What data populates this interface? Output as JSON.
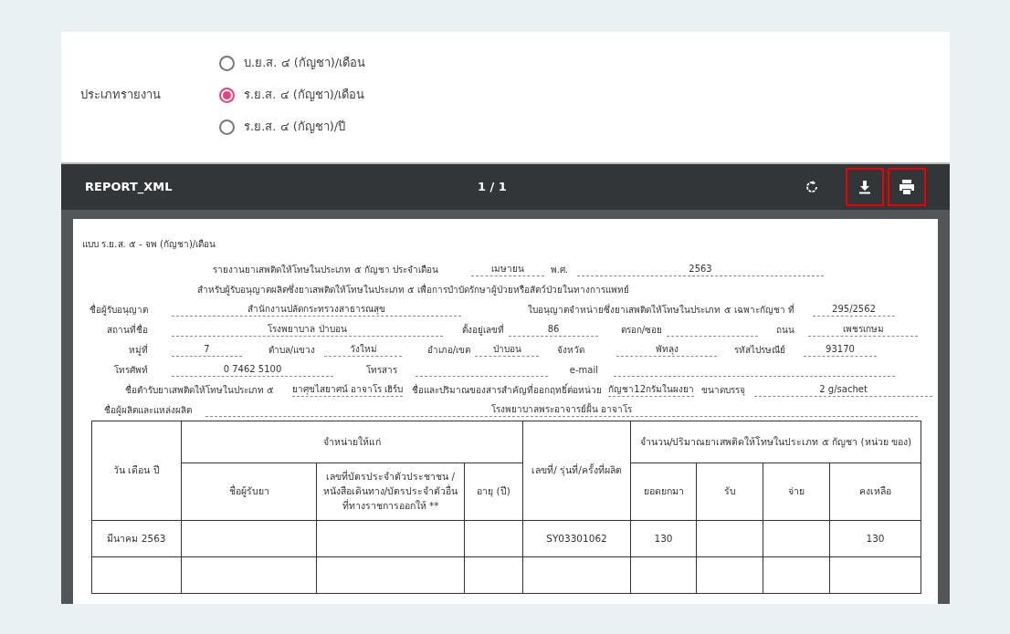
{
  "report_type": {
    "label": "ประเภทรายงาน",
    "options": [
      {
        "label": "บ.ย.ส. ๔ (กัญชา)/เดือน",
        "selected": false
      },
      {
        "label": "ร.ย.ส. ๔ (กัญชา)/เดือน",
        "selected": true
      },
      {
        "label": "ร.ย.ส. ๔ (กัญชา)/ปี",
        "selected": false
      }
    ]
  },
  "viewer": {
    "title": "REPORT_XML",
    "page_indicator": "1 / 1"
  },
  "document": {
    "form_code": "แบบ ร.ย.ส. ๕ - จพ (กัญชา)/เดือน",
    "header_rows": [
      [
        {
          "kind": "label",
          "text": "รายงานยาเสพติดให้โทษในประเภท ๕ กัญชา ประจำเดือน"
        },
        {
          "kind": "value",
          "text": "เมษายน"
        },
        {
          "kind": "label",
          "text": "พ.ศ."
        },
        {
          "kind": "value",
          "text": "2563"
        }
      ],
      [
        {
          "kind": "label",
          "text": "สำหรับผู้รับอนุญาตผลิตซึ่งยาเสพติดให้โทษในประเภท ๕ เพื่อการบำบัดรักษาผู้ป่วยหรือสัตว์ป่วยในทางการแพทย์"
        }
      ],
      [
        {
          "kind": "label",
          "text": "ชื่อผู้รับอนุญาต"
        },
        {
          "kind": "value",
          "text": "สำนักงานปลัดกระทรวงสาธารณสุข"
        },
        {
          "kind": "label",
          "text": "ใบอนุญาตจำหน่ายซึ่งยาเสพติดให้โทษในประเภท ๕ เฉพาะกัญชา ที่"
        },
        {
          "kind": "value",
          "text": "295/2562"
        }
      ],
      [
        {
          "kind": "label",
          "text": "สถานที่ชื่อ"
        },
        {
          "kind": "value",
          "text": "โรงพยาบาล ป่าบอน"
        },
        {
          "kind": "label",
          "text": "ตั้งอยู่เลขที่"
        },
        {
          "kind": "value",
          "text": "86"
        },
        {
          "kind": "label",
          "text": "ตรอก/ซอย"
        },
        {
          "kind": "blank"
        },
        {
          "kind": "label",
          "text": "ถนน"
        },
        {
          "kind": "value",
          "text": "เพชรเกษม"
        }
      ],
      [
        {
          "kind": "label",
          "text": "หมู่ที่"
        },
        {
          "kind": "value",
          "text": "7"
        },
        {
          "kind": "label",
          "text": "ตำบล/แขวง"
        },
        {
          "kind": "value",
          "text": "วังใหม่"
        },
        {
          "kind": "label",
          "text": "อำเภอ/เขต"
        },
        {
          "kind": "value",
          "text": "ป่าบอน"
        },
        {
          "kind": "label",
          "text": "จังหวัด"
        },
        {
          "kind": "value",
          "text": "พัทลุง"
        },
        {
          "kind": "label",
          "text": "รหัสไปรษณีย์"
        },
        {
          "kind": "value",
          "text": "93170"
        }
      ],
      [
        {
          "kind": "label",
          "text": "โทรศัพท์"
        },
        {
          "kind": "value",
          "text": "0 7462 5100"
        },
        {
          "kind": "label",
          "text": "โทรสาร"
        },
        {
          "kind": "blank"
        },
        {
          "kind": "label",
          "text": "e-mail"
        },
        {
          "kind": "blank"
        }
      ],
      [
        {
          "kind": "label",
          "text": "ชื่อตำรับยาเสพติดให้โทษในประเภท ๕"
        },
        {
          "kind": "value",
          "text": "ยาศุขไสยาศน์ อาจาโร เฮิร์บ"
        },
        {
          "kind": "label",
          "text": "ชื่อและปริมาณของสารสำคัญที่ออกฤทธิ์ต่อหน่วย"
        },
        {
          "kind": "value",
          "text": "กัญชา12กรัมในผงยา"
        },
        {
          "kind": "label",
          "text": "ขนาดบรรจุ"
        },
        {
          "kind": "value",
          "text": "2 g/sachet"
        }
      ],
      [
        {
          "kind": "label",
          "text": "ชื่อผู้ผลิตและแหล่งผลิต"
        },
        {
          "kind": "value",
          "text": "โรงพยาบาลพระอาจารย์ฝั้น อาจาโร"
        }
      ]
    ],
    "table": {
      "group_headers": [
        "วัน เดือน ปี",
        "จำหน่ายให้แก่",
        "เลขที่/ รุ่นที่/ครั้งที่ผลิต",
        "จำนวน/ปริมาณยาเสพติดให้โทษในประเภท ๕ กัญชา (หน่วย ของ)"
      ],
      "sub_headers": [
        "ชื่อผู้รับยา",
        "เลขที่บัตรประจำตัวประชาชน /หนังสือเดินทาง/บัตรประจำตัวอื่น ที่ทางราชการออกให้ **",
        "อายุ (ปี)",
        "ยอดยกมา",
        "รับ",
        "จ่าย",
        "คงเหลือ"
      ],
      "rows": [
        [
          "มีนาคม 2563",
          null,
          null,
          null,
          "SY03301062",
          "130",
          null,
          null,
          "130"
        ]
      ]
    }
  }
}
